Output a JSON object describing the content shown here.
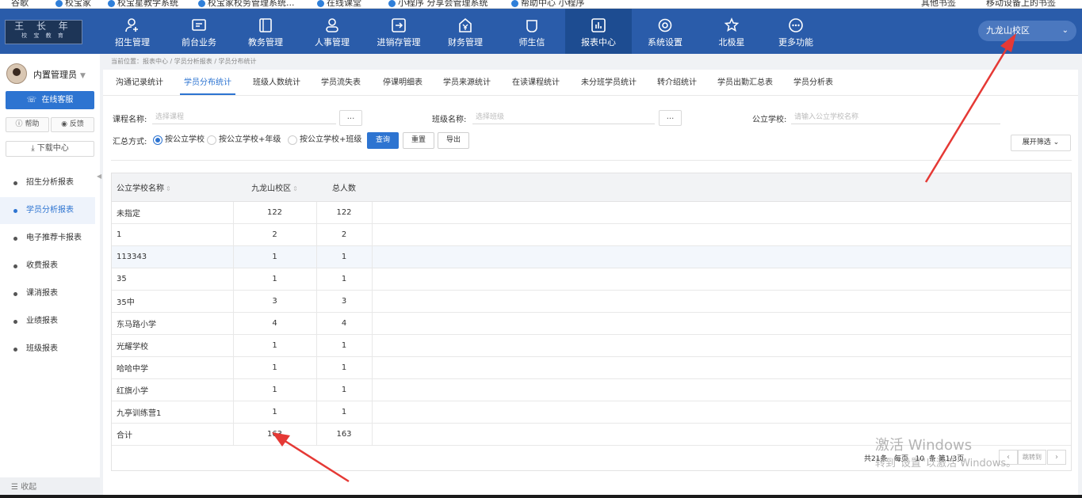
{
  "bookmarks": [
    "谷歌",
    "校宝家",
    "校宝星教学系统",
    "校宝家校务管理系统...",
    "在线课堂",
    "小程序 分享会管理系统",
    "帮助中心 小程序",
    "其他书签",
    "移动设备上的书签"
  ],
  "nav": {
    "items": [
      {
        "label": "招生管理",
        "icon": "user-plus-icon"
      },
      {
        "label": "前台业务",
        "icon": "monitor-icon"
      },
      {
        "label": "教务管理",
        "icon": "book-icon"
      },
      {
        "label": "人事管理",
        "icon": "person-icon"
      },
      {
        "label": "进销存管理",
        "icon": "inventory-icon"
      },
      {
        "label": "财务管理",
        "icon": "yen-icon"
      },
      {
        "label": "师生信",
        "icon": "chat-icon"
      },
      {
        "label": "报表中心",
        "icon": "report-icon"
      },
      {
        "label": "系统设置",
        "icon": "gear-icon"
      },
      {
        "label": "北极星",
        "icon": "star-icon"
      },
      {
        "label": "更多功能",
        "icon": "more-icon"
      }
    ],
    "active": "报表中心",
    "campus": "九龙山校区"
  },
  "sidebar": {
    "user": "内置管理员",
    "service_btn": "在线客服",
    "help_btn": "帮助",
    "feedback_btn": "反馈",
    "download_btn": "下载中心",
    "menu": [
      "招生分析报表",
      "学员分析报表",
      "电子推荐卡报表",
      "收费报表",
      "课消报表",
      "业绩报表",
      "班级报表"
    ],
    "active_menu": "学员分析报表",
    "collapse": "收起"
  },
  "breadcrumb": "当前位置：报表中心 / 学员分析报表 / 学员分布统计",
  "tabs": [
    "沟通记录统计",
    "学员分布统计",
    "班级人数统计",
    "学员流失表",
    "停课明细表",
    "学员来源统计",
    "在读课程统计",
    "未分班学员统计",
    "转介绍统计",
    "学员出勤汇总表",
    "学员分析表"
  ],
  "active_tab": "学员分布统计",
  "filters": {
    "course_label": "课程名称:",
    "course_placeholder": "选择课程",
    "class_label": "班级名称:",
    "class_placeholder": "选择班级",
    "school_label": "公立学校:",
    "school_placeholder": "请输入公立学校名称",
    "dots": "...",
    "summary_label": "汇总方式:",
    "summary_options": [
      "按公立学校",
      "按公立学校+年级",
      "按公立学校+班级"
    ],
    "summary_selected": 0,
    "query_btn": "查询",
    "reset_btn": "重置",
    "export_btn": "导出",
    "expand_btn": "展开筛选"
  },
  "table": {
    "headers": [
      "公立学校名称",
      "九龙山校区",
      "总人数"
    ],
    "rows": [
      [
        "未指定",
        "122",
        "122"
      ],
      [
        "1",
        "2",
        "2"
      ],
      [
        "113343",
        "1",
        "1"
      ],
      [
        "35",
        "1",
        "1"
      ],
      [
        "35中",
        "3",
        "3"
      ],
      [
        "东马路小学",
        "4",
        "4"
      ],
      [
        "光耀学校",
        "1",
        "1"
      ],
      [
        "哈哈中学",
        "1",
        "1"
      ],
      [
        "红旗小学",
        "1",
        "1"
      ],
      [
        "九亭训练营1",
        "1",
        "1"
      ]
    ],
    "total_row": [
      "合计",
      "163",
      "163"
    ]
  },
  "pagination": {
    "total_text": "共21条",
    "per_page_label": "每页",
    "per_page": "10",
    "page_text": "条  第1/3页",
    "prev": "‹",
    "next": "›",
    "goto": "跳转到"
  },
  "watermark": {
    "title": "激活 Windows",
    "subtitle": "转到\"设置\"以激活 Windows。"
  },
  "colors": {
    "nav_bg": "#2a5caa",
    "accent": "#2d74d1",
    "annotation_arrow": "#e53935"
  }
}
